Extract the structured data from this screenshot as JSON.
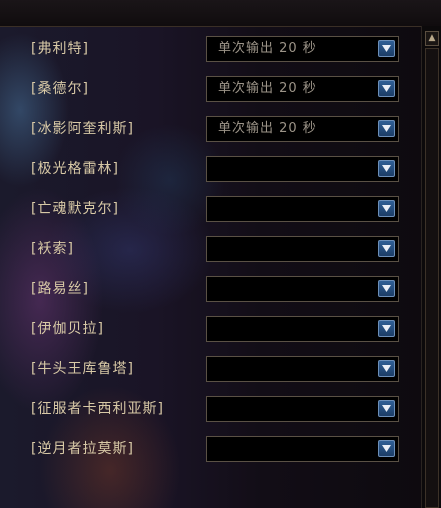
{
  "scrollbar": {
    "up_glyph": "▲"
  },
  "rows": [
    {
      "label": "[弗利特]",
      "value": "单次输出 20 秒"
    },
    {
      "label": "[桑德尔]",
      "value": "单次输出 20 秒"
    },
    {
      "label": "[冰影阿奎利斯]",
      "value": "单次输出 20 秒"
    },
    {
      "label": "[极光格雷林]",
      "value": ""
    },
    {
      "label": "[亡魂默克尔]",
      "value": ""
    },
    {
      "label": "[袄索]",
      "value": ""
    },
    {
      "label": "[路易丝]",
      "value": ""
    },
    {
      "label": "[伊伽贝拉]",
      "value": ""
    },
    {
      "label": "[牛头王库鲁塔]",
      "value": ""
    },
    {
      "label": "[征服者卡西利亚斯]",
      "value": ""
    },
    {
      "label": "[逆月者拉莫斯]",
      "value": ""
    }
  ],
  "colors": {
    "label_text": "#d8c9a6",
    "dropdown_text": "#9c9488",
    "dropdown_button": "#2f5f96"
  }
}
